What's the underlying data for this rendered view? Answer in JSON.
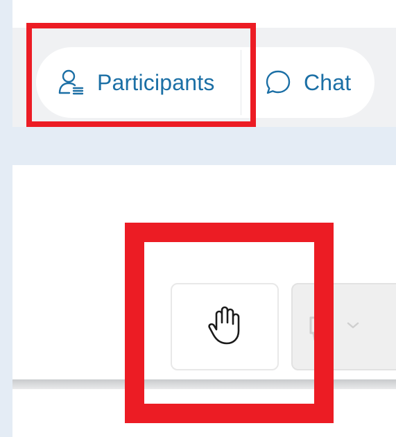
{
  "tabs": {
    "participants": {
      "label": "Participants",
      "icon": "participants-icon"
    },
    "chat": {
      "label": "Chat",
      "icon": "chat-icon"
    }
  },
  "toolbar": {
    "raise_hand": {
      "icon": "raise-hand-icon"
    },
    "speaker": {
      "icon": "speaker-icon",
      "dropdown_icon": "chevron-down-icon"
    }
  },
  "colors": {
    "accent": "#1b6fa5",
    "highlight": "#ec1c24",
    "page_background": "#e4ecf5"
  }
}
